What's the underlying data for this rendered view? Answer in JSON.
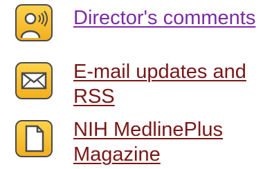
{
  "links": [
    {
      "label": "Director's comments",
      "icon": "podcast-person-icon",
      "color": "#7b2aa6"
    },
    {
      "label_line1": "E-mail updates and",
      "label_line2": "RSS",
      "icon": "envelope-icon",
      "color": "#7a1616"
    },
    {
      "label_line1": "NIH MedlinePlus",
      "label_line2": "Magazine",
      "icon": "document-icon",
      "color": "#7a1616"
    }
  ],
  "colors": {
    "icon_fill": "#f2b01e",
    "icon_border": "#4a4a4a"
  }
}
